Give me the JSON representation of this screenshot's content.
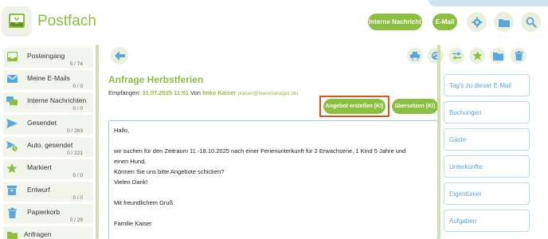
{
  "app": {
    "title": "Postfach"
  },
  "header": {
    "internal_message_label": "Interne Nachricht",
    "email_label": "E-Mail",
    "icons": [
      "gear-icon",
      "folder-icon",
      "search-icon"
    ]
  },
  "sidebar": {
    "items": [
      {
        "label": "Posteingang",
        "count": "5 / 74",
        "icon": "inbox-icon"
      },
      {
        "label": "Meine E-Mails",
        "count": "0 / 0",
        "icon": "mail-icon"
      },
      {
        "label": "Interne Nachrichten",
        "count": "0 / 0",
        "icon": "chat-icon"
      },
      {
        "label": "Gesendet",
        "count": "0 / 263",
        "icon": "send-icon"
      },
      {
        "label": "Auto. gesendet",
        "count": "0 / 221",
        "icon": "auto-send-icon"
      },
      {
        "label": "Markiert",
        "count": "0 / 0",
        "icon": "star-icon"
      },
      {
        "label": "Entwurf",
        "count": "0 / 0",
        "icon": "draft-icon"
      },
      {
        "label": "Papierkorb",
        "count": "0 / 29",
        "icon": "trash-icon"
      },
      {
        "label": "Anfragen",
        "count": "",
        "icon": "folder-icon"
      }
    ]
  },
  "message": {
    "subject": "Anfrage Herbstferien",
    "received_label": "Empfangen:",
    "received_date": "31.07.2025 11:51",
    "from_label": "Von",
    "sender_name": "Imke Kaiser",
    "sender_email": "(kaiser@fewomanager.de)",
    "body": [
      "Hallo,",
      "",
      "wir suchen für den Zeitraum 11.-18.10.2025 nach einer Ferienunterkunft für 2 Erwachsene, 1 Kind 5 Jahre und",
      "einen Hund.",
      "Können Sie uns bitte Angebote schicken?",
      "Vielen Dank!",
      "",
      "Mit freundlichem Gruß",
      "",
      "Familie Kaiser"
    ]
  },
  "actions": {
    "create_offer_label": "Angebot erstellen (KI)",
    "translate_label": "übersetzen (KI)"
  },
  "toolbar": {
    "icons": [
      "print-icon",
      "refresh-icon",
      "forward-icon",
      "star-icon",
      "folder-icon",
      "trash-icon"
    ]
  },
  "right_panel": {
    "items": [
      "Tag's zu dieser E-Mail",
      "Buchungen",
      "Gäste",
      "Unterkünfte",
      "Eigentümer",
      "Aufgaben"
    ]
  },
  "colors": {
    "accent": "#8cbf3f",
    "link_blue": "#58a8df",
    "highlight": "#e0531b"
  }
}
